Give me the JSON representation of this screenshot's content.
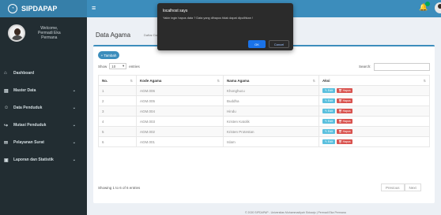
{
  "app": {
    "logo_text": "SIPDAPAP"
  },
  "user_panel": {
    "welcome": "Welcome,",
    "name_line1": "Permadi Eka",
    "name_line2": "Permana"
  },
  "menu": [
    {
      "label": "Dashboard",
      "icon": "home-icon",
      "glyph": "⌂",
      "has_children": false
    },
    {
      "label": "Master Data",
      "icon": "list-icon",
      "glyph": "▤",
      "has_children": true
    },
    {
      "label": "Data Penduduk",
      "icon": "users-icon",
      "glyph": "☺",
      "has_children": true
    },
    {
      "label": "Mutasi Penduduk",
      "icon": "share-icon",
      "glyph": "↪",
      "has_children": true
    },
    {
      "label": "Pelayanan Surat",
      "icon": "envelope-icon",
      "glyph": "✉",
      "has_children": true
    },
    {
      "label": "Laporan dan Statistik",
      "icon": "file-icon",
      "glyph": "▣",
      "has_children": true
    }
  ],
  "header": {
    "user_name": "permadi",
    "user_caret": "⌄"
  },
  "page": {
    "title": "Data Agama",
    "subtitle": "Daftar Data Agama"
  },
  "toolbar": {
    "add_label": "+ Tambah"
  },
  "table_controls": {
    "show_label": "Show",
    "entries_value": "10",
    "entries_label": "entries",
    "search_label": "Search:"
  },
  "table": {
    "headers": [
      "No.",
      "Kode Agama",
      "Nama Agama",
      "Aksi"
    ],
    "rows": [
      {
        "no": "1",
        "kode": "AGM.006",
        "nama": "Khonghucu"
      },
      {
        "no": "2",
        "kode": "AGM.005",
        "nama": "Buddha"
      },
      {
        "no": "3",
        "kode": "AGM.004",
        "nama": "Hindu"
      },
      {
        "no": "4",
        "kode": "AGM.003",
        "nama": "Kristen Katolik"
      },
      {
        "no": "5",
        "kode": "AGM.002",
        "nama": "Kristen Protestan"
      },
      {
        "no": "6",
        "kode": "AGM.001",
        "nama": "Islam"
      }
    ],
    "edit_label": "✎ Edit",
    "delete_label": "🗑 Hapus"
  },
  "pagination": {
    "info": "Showing 1 to 6 of 6 entries",
    "previous": "Previous",
    "next": "Next"
  },
  "footer": {
    "text": "© 2020 SIPDAPAP - Universitas Muhammadiyah Sidoarjo | Permadi Eka Permana"
  },
  "dialog": {
    "title": "localhost says",
    "message": "Yakin ingin hapus data ? Data yang dihapus tidak dapat dipulihkan !",
    "ok": "OK",
    "cancel": "Cancel"
  },
  "colors": {
    "sidebar": "#222d32",
    "header": "#3c8dbc",
    "logo_bg": "#367fa9",
    "edit": "#5bc0de",
    "delete": "#d9534f"
  }
}
